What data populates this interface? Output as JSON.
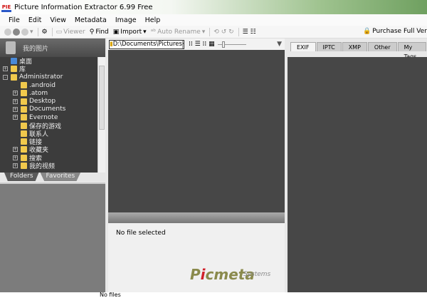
{
  "title": {
    "logo": "PIE",
    "text": "Picture Information Extractor 6.99 Free"
  },
  "menu": [
    "File",
    "Edit",
    "View",
    "Metadata",
    "Image",
    "Help"
  ],
  "toolbar": {
    "viewer": "Viewer",
    "find": "Find",
    "import": "Import",
    "auto_rename": "Auto Rename",
    "purchase": "Purchase Full Version"
  },
  "left": {
    "header": "我的图片",
    "tree": [
      {
        "label": "桌面",
        "level": 0,
        "exp": ""
      },
      {
        "label": "库",
        "level": 0,
        "exp": "+"
      },
      {
        "label": "Administrator",
        "level": 0,
        "exp": "-"
      },
      {
        "label": ".android",
        "level": 1,
        "exp": ""
      },
      {
        "label": ".atom",
        "level": 1,
        "exp": "+"
      },
      {
        "label": "Desktop",
        "level": 1,
        "exp": "+"
      },
      {
        "label": "Documents",
        "level": 1,
        "exp": "+"
      },
      {
        "label": "Evernote",
        "level": 1,
        "exp": "+"
      },
      {
        "label": "保存的游戏",
        "level": 1,
        "exp": ""
      },
      {
        "label": "联系人",
        "level": 1,
        "exp": ""
      },
      {
        "label": "链接",
        "level": 1,
        "exp": ""
      },
      {
        "label": "收藏夹",
        "level": 1,
        "exp": "+"
      },
      {
        "label": "搜索",
        "level": 1,
        "exp": "+"
      },
      {
        "label": "我的视频",
        "level": 1,
        "exp": "+"
      }
    ],
    "tabs": [
      "Folders",
      "Favorites"
    ]
  },
  "middle": {
    "path": "D:\\Documents\\Pictures",
    "no_file": "No file selected",
    "brand": "Picmeta",
    "brand_sub": "Systems"
  },
  "right": {
    "tabs": [
      "EXIF",
      "IPTC",
      "XMP",
      "Other",
      "My Tags"
    ]
  },
  "status": "No files"
}
